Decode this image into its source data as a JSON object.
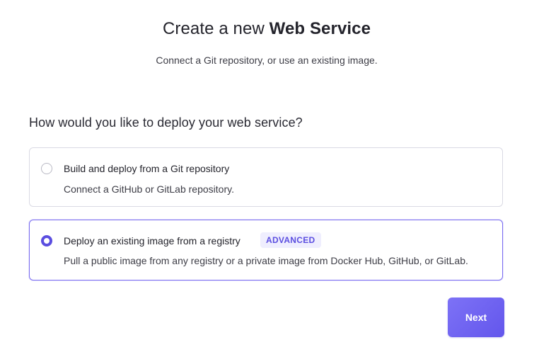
{
  "header": {
    "title_prefix": "Create a new ",
    "title_bold": "Web Service",
    "subtitle": "Connect a Git repository, or use an existing image."
  },
  "form": {
    "question": "How would you like to deploy your web service?",
    "options": [
      {
        "title": "Build and deploy from a Git repository",
        "description": "Connect a GitHub or GitLab repository.",
        "selected": false
      },
      {
        "title": "Deploy an existing image from a registry",
        "badge": "ADVANCED",
        "description": "Pull a public image from any registry or a private image from Docker Hub, GitHub, or GitLab.",
        "selected": true
      }
    ]
  },
  "actions": {
    "next_label": "Next"
  },
  "colors": {
    "accent": "#5b4ee0",
    "button_gradient_start": "#7d72f6",
    "button_gradient_end": "#6356ec",
    "badge_bg": "#efeefe",
    "card_border": "#dadae4",
    "selected_border": "#7a6df0"
  }
}
